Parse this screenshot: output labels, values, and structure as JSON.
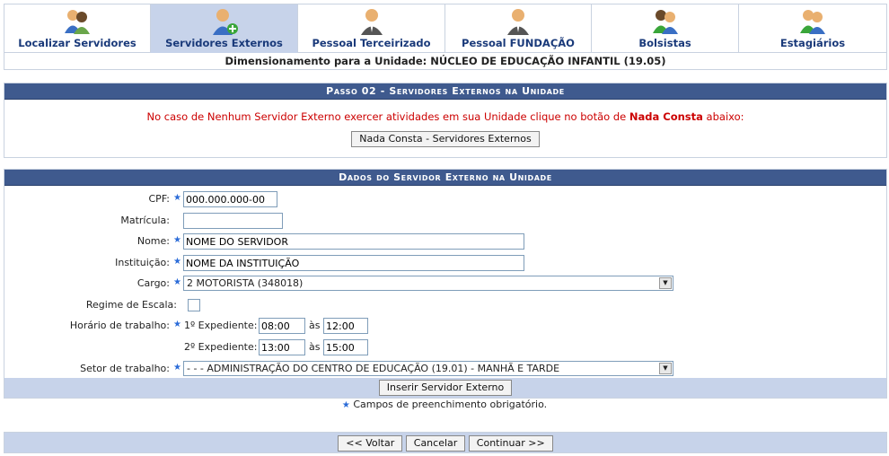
{
  "tabs": [
    {
      "label": "Localizar Servidores",
      "icon": "users-icon",
      "active": false
    },
    {
      "label": "Servidores Externos",
      "icon": "user-add-icon",
      "active": true
    },
    {
      "label": "Pessoal Terceirizado",
      "icon": "suit-user-icon",
      "active": false
    },
    {
      "label": "Pessoal FUNDAÇÃO",
      "icon": "suit-user-icon",
      "active": false
    },
    {
      "label": "Bolsistas",
      "icon": "users-icon",
      "active": false
    },
    {
      "label": "Estagiários",
      "icon": "users-icon",
      "active": false
    }
  ],
  "dimension_title": "Dimensionamento para a Unidade: NÚCLEO DE EDUCAÇÃO INFANTIL (19.05)",
  "step": {
    "caption": "Passo 02 - Servidores Externos na Unidade",
    "warning_pre": "No caso de Nenhum Servidor Externo exercer atividades em sua Unidade clique no botão de ",
    "warning_bold": "Nada Consta",
    "warning_post": " abaixo:",
    "nada_consta_button": "Nada Consta - Servidores Externos"
  },
  "form": {
    "caption": "Dados do Servidor Externo na Unidade",
    "cpf_label": "CPF:",
    "cpf_value": "000.000.000-00",
    "matricula_label": "Matrícula:",
    "matricula_value": "",
    "nome_label": "Nome:",
    "nome_value": "NOME DO SERVIDOR",
    "instituicao_label": "Instituição:",
    "instituicao_value": "NOME DA INSTITUIÇÃO",
    "cargo_label": "Cargo:",
    "cargo_value": "2 MOTORISTA (348018)",
    "regime_label": "Regime de Escala:",
    "horario_label": "Horário de trabalho:",
    "exp1_label": "1º Expediente:",
    "exp1_start": "08:00",
    "exp1_sep": "às",
    "exp1_end": "12:00",
    "exp2_label": "2º Expediente:",
    "exp2_start": "13:00",
    "exp2_sep": "às",
    "exp2_end": "15:00",
    "setor_label": "Setor de trabalho:",
    "setor_value": "- - - ADMINISTRAÇÃO DO CENTRO DE EDUCAÇÃO (19.01) - MANHÃ E TARDE",
    "insert_button": "Inserir Servidor Externo",
    "required_note": "Campos de preenchimento obrigatório."
  },
  "nav": {
    "back": "<< Voltar",
    "cancel": "Cancelar",
    "next": "Continuar >>"
  },
  "colors": {
    "header": "#3f5a8e",
    "tab_active": "#c7d3ea",
    "warning": "#cc0000",
    "required_star": "#2a6bd8"
  }
}
